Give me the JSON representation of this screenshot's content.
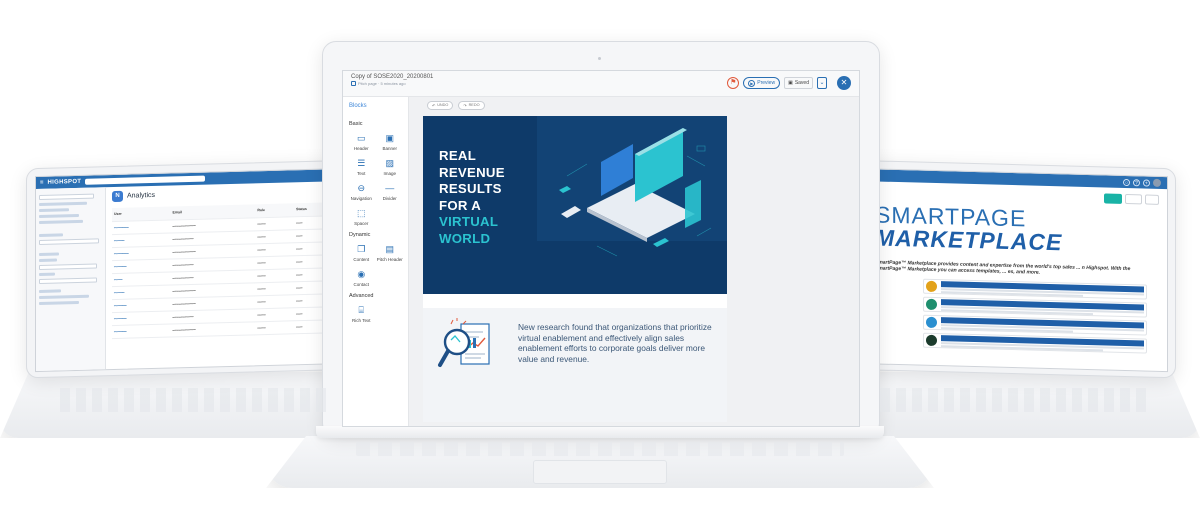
{
  "left_screen": {
    "brand": "HIGHSPOT",
    "title": "Analytics",
    "table_headers": [
      "User",
      "Email",
      "Role",
      "Status"
    ],
    "row_count": 9
  },
  "center_screen": {
    "doc_title": "Copy of SOSE2020_20200801",
    "doc_meta": "Pitch page · 5 minutes ago",
    "preview_label": "Preview",
    "saved_label": "Saved",
    "undo_label": "UNDO",
    "redo_label": "REDO",
    "sidebar": {
      "title": "Blocks",
      "sections": [
        {
          "name": "Basic",
          "items": [
            "Header",
            "Banner",
            "Text",
            "Image",
            "Navigation",
            "Divider",
            "Spacer"
          ]
        },
        {
          "name": "Dynamic",
          "items": [
            "Content",
            "Pitch Header",
            "Contact"
          ]
        },
        {
          "name": "Advanced",
          "items": [
            "Rich Text"
          ]
        }
      ]
    },
    "banner": {
      "line1": "REAL",
      "line2": "REVENUE",
      "line3": "RESULTS",
      "line4": "FOR A",
      "line5": "VIRTUAL",
      "line6": "WORLD",
      "bg_color": "#0e3a69",
      "accent_color": "#2bc3d0"
    },
    "research_text": "New research found that organizations that prioritize virtual enablement and effectively align sales enablement efforts to corporate goals deliver more value and revenue."
  },
  "right_screen": {
    "heading_line1": "SMARTPAGE",
    "heading_line2": "MARKETPLACE",
    "intro": "SmartPage™ Marketplace provides content and expertise from the world's top sales ... n Highspot. With the SmartPage™ Marketplace you can access templates, ... es, and more."
  }
}
